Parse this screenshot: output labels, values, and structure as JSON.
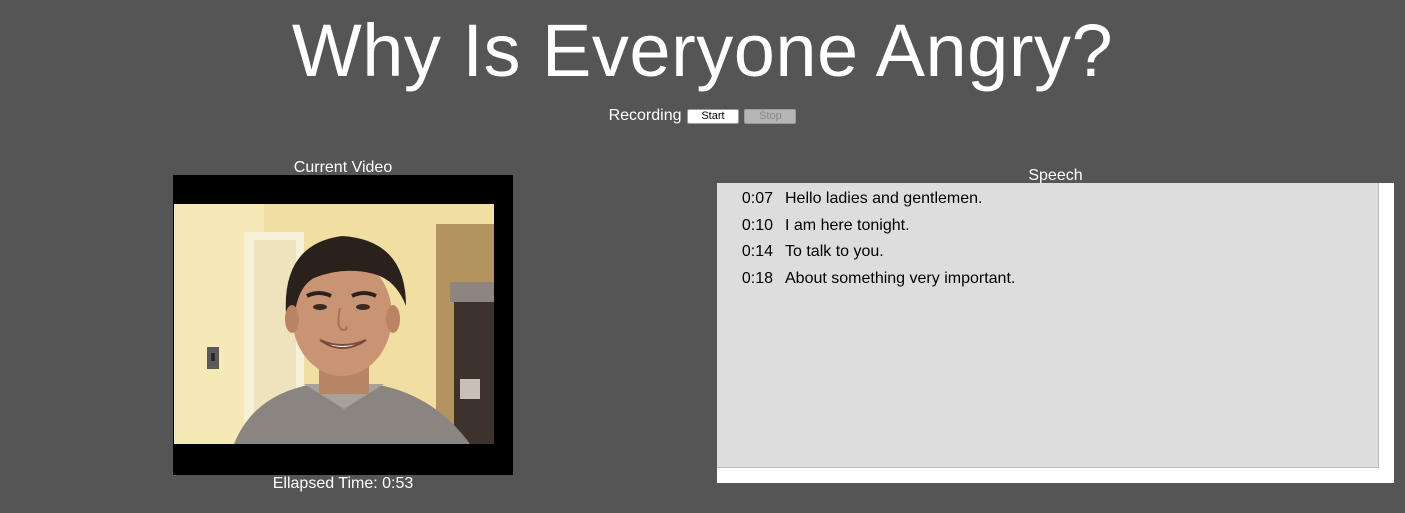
{
  "header": {
    "title": "Why Is Everyone Angry?"
  },
  "recording": {
    "label": "Recording",
    "start_label": "Start",
    "stop_label": "Stop"
  },
  "video": {
    "label": "Current Video",
    "elapsed_prefix": "Ellapsed Time:",
    "elapsed_value": "0:53"
  },
  "speech": {
    "label": "Speech",
    "lines": [
      {
        "time": "0:07",
        "text": "Hello ladies and gentlemen."
      },
      {
        "time": "0:10",
        "text": "I am here tonight."
      },
      {
        "time": "0:14",
        "text": "To talk to you."
      },
      {
        "time": "0:18",
        "text": "About something very important."
      }
    ]
  },
  "colors": {
    "background": "#555555",
    "text": "#ffffff",
    "speech_panel": "#dddddd",
    "video_frame": "#000000"
  }
}
